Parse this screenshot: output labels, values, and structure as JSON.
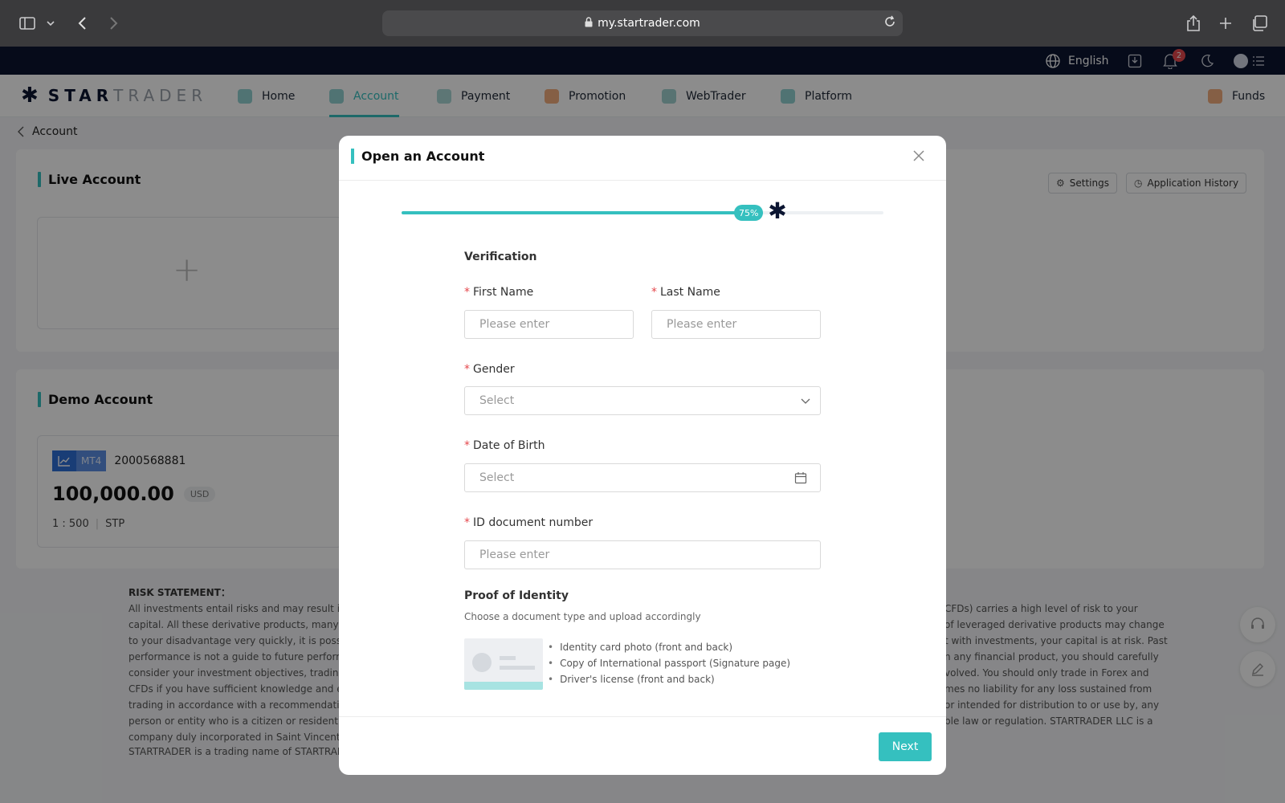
{
  "browser": {
    "url": "my.startrader.com",
    "icons": [
      "sidebar-icon",
      "chevron-down-icon",
      "back-icon",
      "forward-icon",
      "lock-icon",
      "reload-icon",
      "share-icon",
      "plus-icon",
      "tabs-icon"
    ]
  },
  "topbar": {
    "language": "English",
    "notification_count": "2"
  },
  "nav": {
    "logo_part1": "STAR",
    "logo_part2": "TRADER",
    "items": [
      {
        "label": "Home"
      },
      {
        "label": "Account"
      },
      {
        "label": "Payment"
      },
      {
        "label": "Promotion"
      },
      {
        "label": "WebTrader"
      },
      {
        "label": "Platform"
      }
    ],
    "active": "Account",
    "funds": "Funds"
  },
  "page": {
    "breadcrumb": "Account",
    "live_account_title": "Live Account",
    "settings_label": "Settings",
    "history_label": "Application History",
    "demo_account_title": "Demo Account",
    "demo_card": {
      "platform": "MT4",
      "account_number": "2000568881",
      "balance": "100,000.00",
      "currency": "USD",
      "leverage": "1 : 500",
      "type": "STP"
    },
    "risk_title": "RISK STATEMENT：",
    "risk_lines": [
      "All investments entail risks and may result in bo",
      "capital. All these derivative products, many of w",
      "to your disadvantage very quickly, it is possible t",
      "performance is not a guide to future performanc",
      "consider your investment objectives, trading kn",
      "CFDs if you have sufficient knowledge and expe",
      "trading in accordance with a recommendation. T",
      "person or entity who is a citizen or resident of or",
      "company duly incorporated in Saint Vincent & Th"
    ],
    "risk_lines_right": [
      "CFDs) carries a high level of risk to your",
      "of leveraged derivative products may change",
      "t with investments, your capital is at risk. Past",
      "n any financial product, you should carefully",
      "volved. You should only trade in Forex and",
      "mes no liability for any loss sustained from",
      "or intended for distribution to or use by, any",
      "ble law or regulation. STARTRADER LLC is a"
    ],
    "risk_footer": "STARTRADER is a trading name of STARTRADER"
  },
  "modal": {
    "title": "Open an Account",
    "progress_label": "75%",
    "progress": 0.75,
    "section_verification": "Verification",
    "first_name_label": "First Name",
    "first_name_placeholder": "Please enter",
    "last_name_label": "Last Name",
    "last_name_placeholder": "Please enter",
    "gender_label": "Gender",
    "gender_value": "Select",
    "dob_label": "Date of Birth",
    "dob_value": "Select",
    "id_label": "ID document number",
    "id_placeholder": "Please enter",
    "proof_title": "Proof of Identity",
    "proof_subtitle": "Choose a document type and upload accordingly",
    "proof_items": [
      "Identity card photo (front and back)",
      "Copy of International passport (Signature page)",
      "Driver's license (front and back)"
    ],
    "next_label": "Next"
  },
  "colors": {
    "accent": "#35c0bf",
    "navy": "#0b1531",
    "required": "#e5484d"
  }
}
